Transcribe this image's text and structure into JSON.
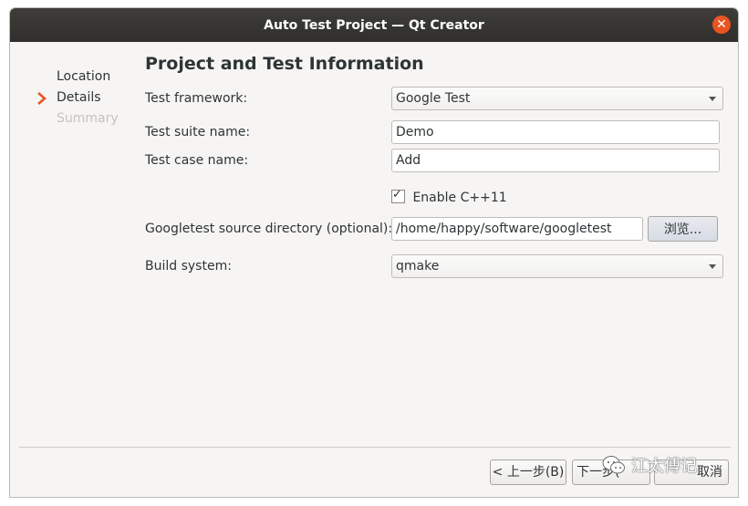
{
  "window": {
    "title": "Auto Test Project — Qt Creator",
    "close_glyph": "✕"
  },
  "sidebar": {
    "steps": [
      {
        "label": "Location",
        "state": "done"
      },
      {
        "label": "Details",
        "state": "current"
      },
      {
        "label": "Summary",
        "state": "disabled"
      }
    ]
  },
  "page": {
    "heading": "Project and Test Information"
  },
  "form": {
    "framework_label": "Test framework:",
    "framework_value": "Google Test",
    "suite_label": "Test suite name:",
    "suite_value": "Demo",
    "case_label": "Test case name:",
    "case_value": "Add",
    "cpp11_label": "Enable C++11",
    "cpp11_checked": true,
    "gtest_dir_label": "Googletest source directory (optional):",
    "gtest_dir_value": "/home/happy/software/googletest",
    "browse_label": "浏览...",
    "build_label": "Build system:",
    "build_value": "qmake"
  },
  "footer": {
    "back_label": "< 上一步(B)",
    "next_label": "下一步(",
    "cancel_label": "取消"
  },
  "watermark": {
    "text": "江太傅记"
  },
  "colors": {
    "accent": "#e95420",
    "titlebar": "#302f2c",
    "window_bg": "#f6f5f4"
  }
}
